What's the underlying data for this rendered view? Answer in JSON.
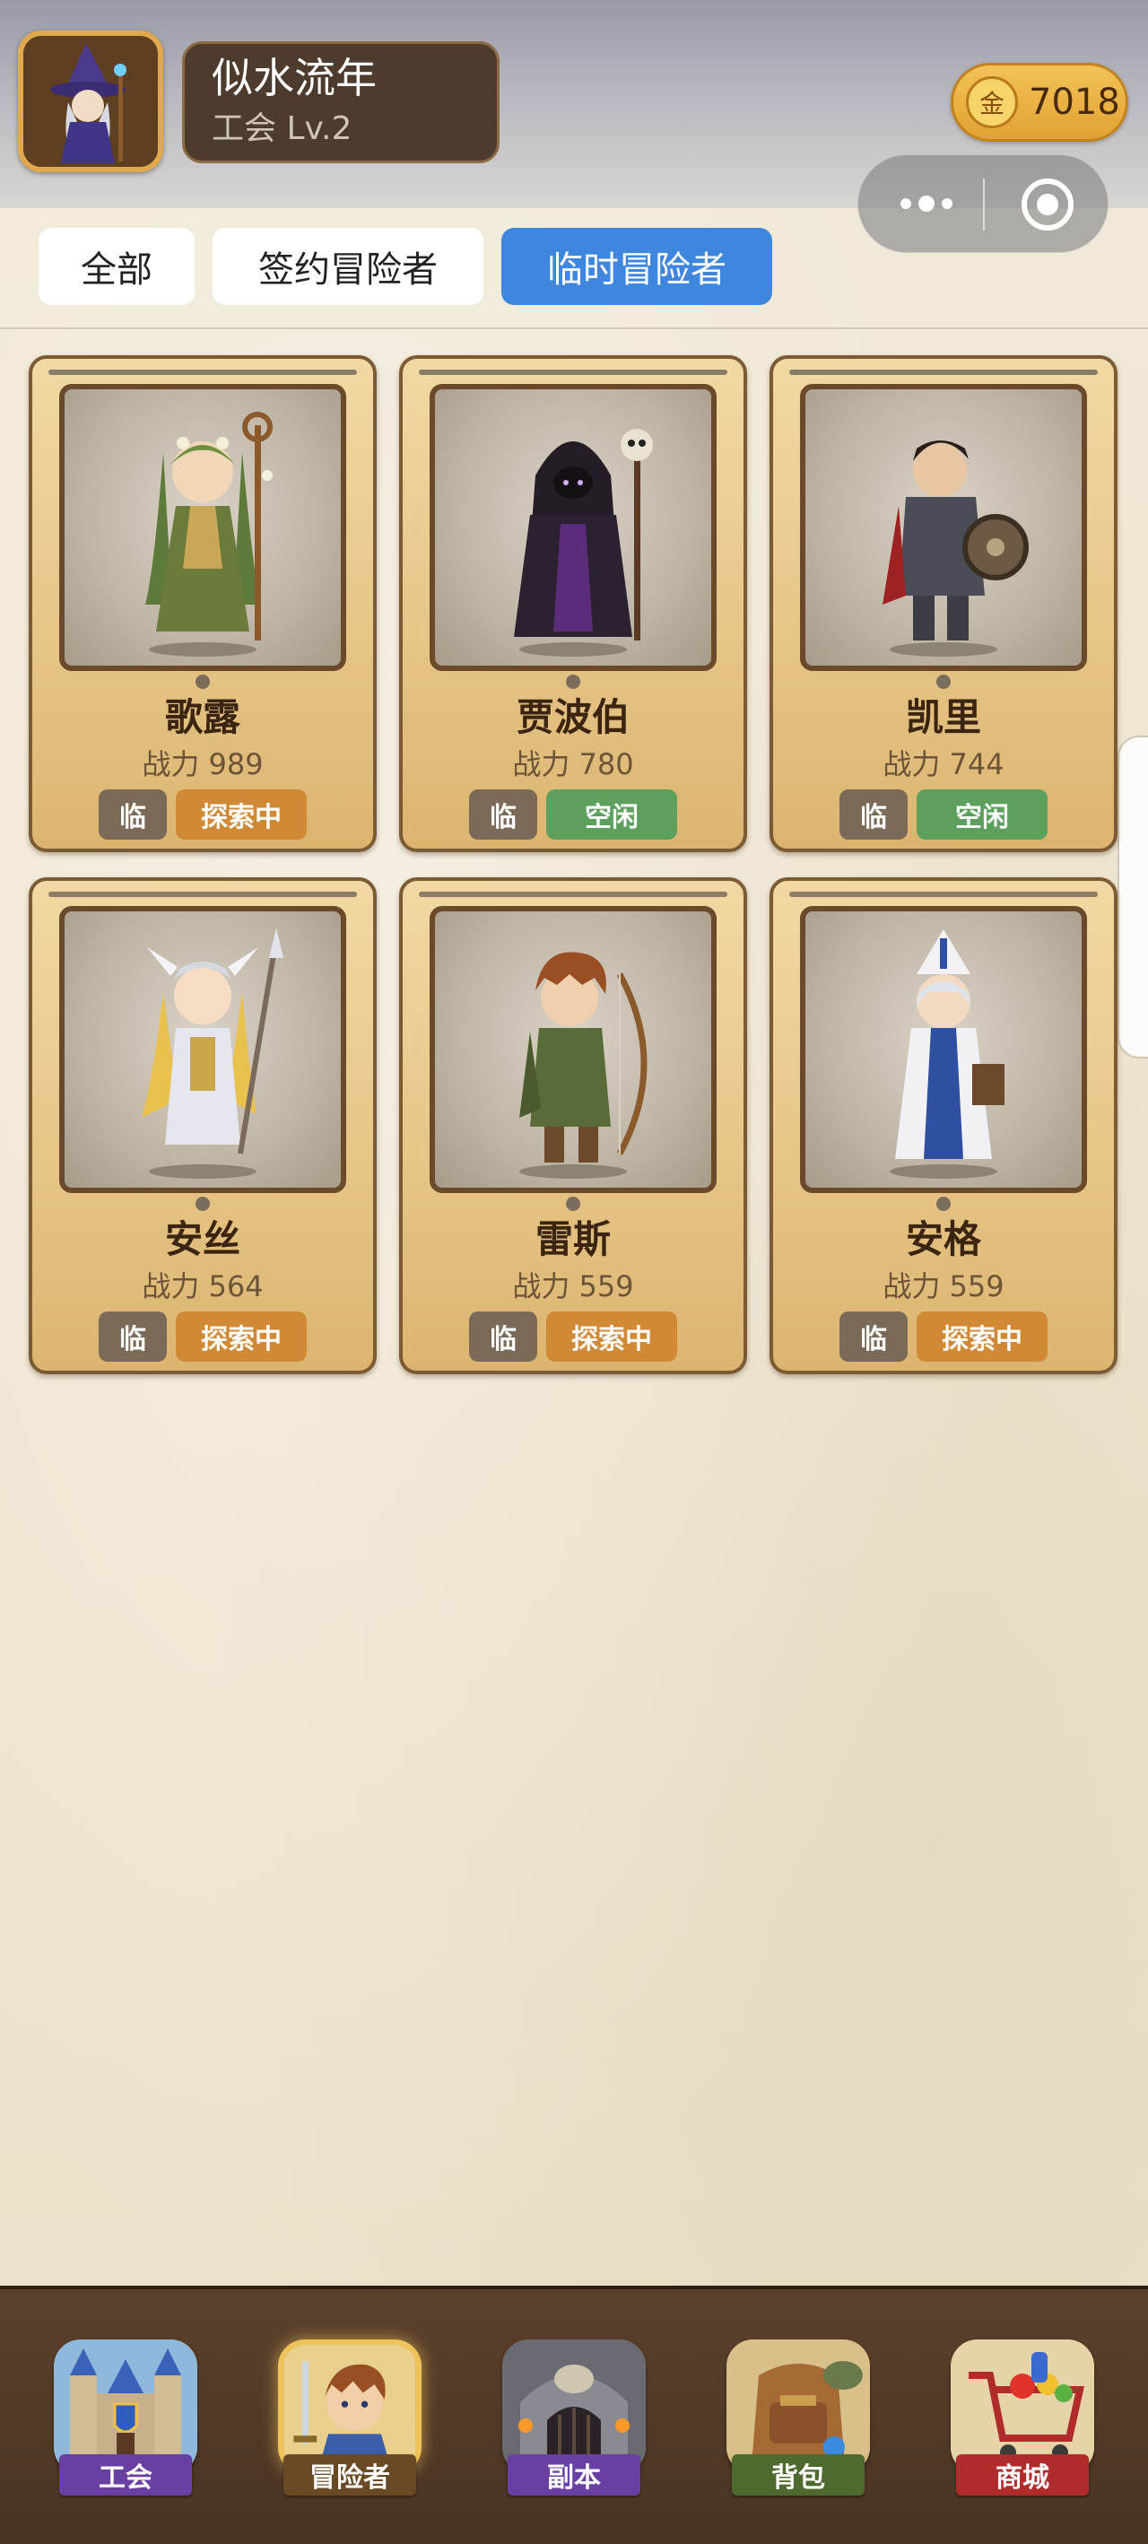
{
  "header": {
    "player_name": "似水流年",
    "guild_level": "工会 Lv.2",
    "gold_icon_label": "金",
    "gold_amount": "7018",
    "avatar_icon": "wizard-avatar-icon"
  },
  "tabs": [
    {
      "label": "全部",
      "active": false
    },
    {
      "label": "签约冒险者",
      "active": false
    },
    {
      "label": "临时冒险者",
      "active": true
    }
  ],
  "adventurers": [
    {
      "name": "歌露",
      "power_label": "战力",
      "power": "989",
      "type_badge": "临",
      "status": "探索中",
      "status_color": "#d08a36",
      "portrait": "druid-portrait-icon"
    },
    {
      "name": "贾波伯",
      "power_label": "战力",
      "power": "780",
      "type_badge": "临",
      "status": "空闲",
      "status_color": "#5d9f5c",
      "portrait": "necromancer-portrait-icon"
    },
    {
      "name": "凯里",
      "power_label": "战力",
      "power": "744",
      "type_badge": "临",
      "status": "空闲",
      "status_color": "#5d9f5c",
      "portrait": "knight-portrait-icon"
    },
    {
      "name": "安丝",
      "power_label": "战力",
      "power": "564",
      "type_badge": "临",
      "status": "探索中",
      "status_color": "#d08a36",
      "portrait": "valkyrie-portrait-icon"
    },
    {
      "name": "雷斯",
      "power_label": "战力",
      "power": "559",
      "type_badge": "临",
      "status": "探索中",
      "status_color": "#d08a36",
      "portrait": "archer-portrait-icon"
    },
    {
      "name": "安格",
      "power_label": "战力",
      "power": "559",
      "type_badge": "临",
      "status": "探索中",
      "status_color": "#d08a36",
      "portrait": "priest-portrait-icon"
    }
  ],
  "bottom_nav": [
    {
      "label": "工会",
      "icon": "castle-icon",
      "label_color": "#6a3fa3",
      "active": false
    },
    {
      "label": "冒险者",
      "icon": "hero-icon",
      "label_color": "#6a4a24",
      "active": true
    },
    {
      "label": "副本",
      "icon": "dungeon-icon",
      "label_color": "#6a3fa3",
      "active": false
    },
    {
      "label": "背包",
      "icon": "backpack-icon",
      "label_color": "#4f6a2e",
      "active": false
    },
    {
      "label": "商城",
      "icon": "shop-cart-icon",
      "label_color": "#b02c2c",
      "active": false
    }
  ],
  "capsule": {
    "more_icon": "more-dots-icon",
    "close_icon": "record-target-icon"
  }
}
